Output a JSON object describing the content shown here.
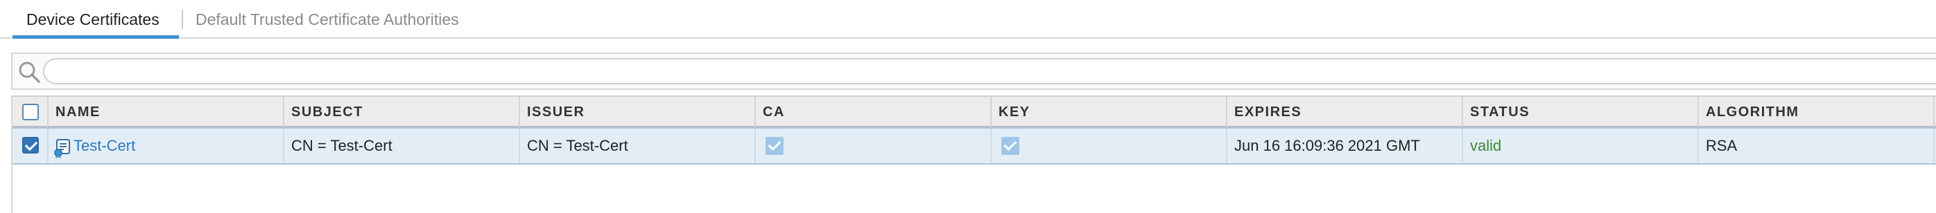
{
  "tabs": [
    {
      "label": "Device Certificates",
      "active": true
    },
    {
      "label": "Default Trusted Certificate Authorities",
      "active": false
    }
  ],
  "search": {
    "value": "",
    "placeholder": ""
  },
  "table": {
    "columns": [
      "NAME",
      "SUBJECT",
      "ISSUER",
      "CA",
      "KEY",
      "EXPIRES",
      "STATUS",
      "ALGORITHM"
    ],
    "rows": [
      {
        "selected": true,
        "name": "Test-Cert",
        "subject": "CN = Test-Cert",
        "issuer": "CN = Test-Cert",
        "ca": true,
        "key": true,
        "expires": "Jun 16 16:09:36 2021 GMT",
        "status": "valid",
        "algorithm": "RSA"
      }
    ]
  },
  "colors": {
    "accent": "#3f8fd0",
    "link": "#2a79c4",
    "status_valid": "#3a8a3a",
    "row_selected_bg": "#e3edf5",
    "header_bg": "#ececec"
  },
  "icons": {
    "search": "search-icon",
    "certificate": "certificate-icon"
  }
}
